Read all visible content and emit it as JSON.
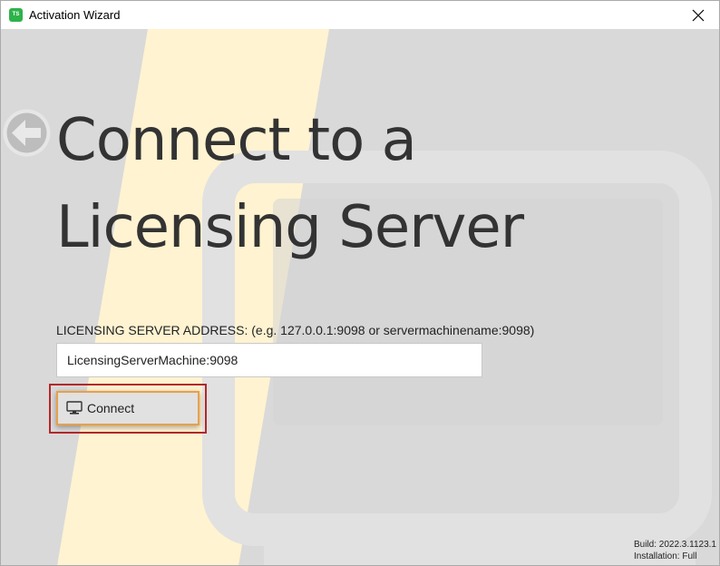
{
  "window": {
    "title": "Activation Wizard",
    "logo_text": "TS",
    "close_icon": "close-icon"
  },
  "page": {
    "heading_line1": "Connect to a",
    "heading_line2": "Licensing Server",
    "back_icon": "arrow-left-circle-icon"
  },
  "form": {
    "address_label": "LICENSING SERVER ADDRESS: (e.g. 127.0.0.1:9098 or servermachinename:9098)",
    "address_value": "LicensingServerMachine:9098",
    "connect_label": "Connect",
    "connect_icon": "monitor-icon"
  },
  "footer": {
    "build": "Build: 2022.3.1123.1",
    "installation": "Installation: Full"
  },
  "colors": {
    "background": "#d9d9d9",
    "stripe": "#fff3d1",
    "accent_orange": "#e8a04c",
    "highlight_red": "#b4282a",
    "logo_green": "#2db34a"
  }
}
